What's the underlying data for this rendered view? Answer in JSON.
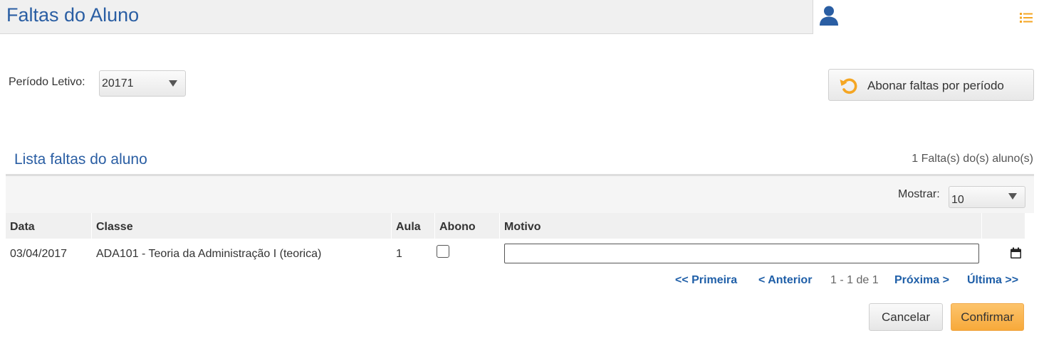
{
  "header": {
    "title": "Faltas do Aluno"
  },
  "colors": {
    "title_blue": "#2a5ea3",
    "accent_orange": "#f5a623",
    "link_blue": "#1f5fa8"
  },
  "icons": [
    "user-icon",
    "list-icon",
    "refresh-icon",
    "calendar-icon"
  ],
  "filters": {
    "periodo_label": "Período Letivo:",
    "periodo_value": "20171"
  },
  "actions": {
    "abonar_label": "Abonar faltas por período"
  },
  "section": {
    "title": "Lista faltas do aluno",
    "count_text": "1 Falta(s) do(s) aluno(s)"
  },
  "table": {
    "mostrar_label": "Mostrar:",
    "mostrar_value": "10",
    "columns": [
      "Data",
      "Classe",
      "Aula",
      "Abono",
      "Motivo"
    ],
    "rows": [
      {
        "data": "03/04/2017",
        "classe": "ADA101 - Teoria da Administração I (teorica)",
        "aula": "1",
        "abono": false,
        "motivo": ""
      }
    ]
  },
  "pagination": {
    "first": "<< Primeira",
    "prev": "< Anterior",
    "info": "1 - 1 de 1",
    "next": "Próxima >",
    "last": "Última >>"
  },
  "footer": {
    "cancel": "Cancelar",
    "confirm": "Confirmar"
  }
}
